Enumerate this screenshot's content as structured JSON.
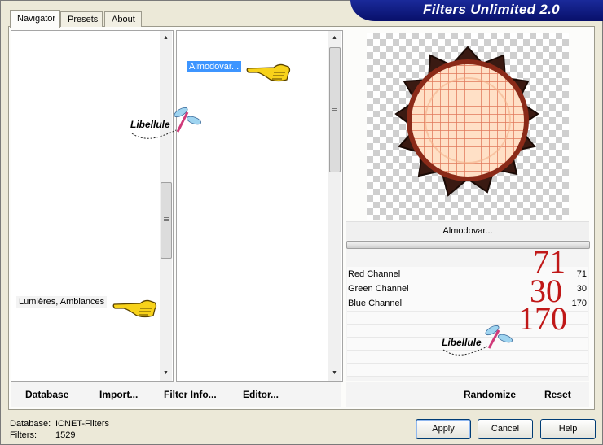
{
  "window": {
    "title": "Filters Unlimited 2.0"
  },
  "tabs": [
    {
      "label": "Navigator",
      "active": true
    },
    {
      "label": "Presets",
      "active": false
    },
    {
      "label": "About",
      "active": false
    }
  ],
  "categories": {
    "selected_item": "Lumières, Ambiances"
  },
  "filters": {
    "selected_item": "Almodovar..."
  },
  "preview": {
    "filter_name": "Almodovar..."
  },
  "watermark": {
    "text": "Libellule"
  },
  "parameters": [
    {
      "name": "Red Channel",
      "value": "71",
      "overlay": "71"
    },
    {
      "name": "Green Channel",
      "value": "30",
      "overlay": "30"
    },
    {
      "name": "Blue Channel",
      "value": "170",
      "overlay": "170"
    }
  ],
  "toolbar": {
    "database_label": "Database",
    "import_label": "Import...",
    "filter_info_label": "Filter Info...",
    "editor_label": "Editor...",
    "randomize_label": "Randomize",
    "reset_label": "Reset"
  },
  "status": {
    "database_label": "Database:",
    "database_value": "ICNET-Filters",
    "filters_label": "Filters:",
    "filters_value": "1529"
  },
  "buttons": {
    "apply_label": "Apply",
    "cancel_label": "Cancel",
    "help_label": "Help"
  },
  "colors": {
    "banner": "#0a1478",
    "selection": "#3d95ff",
    "overlay_numbers": "#c01818"
  }
}
